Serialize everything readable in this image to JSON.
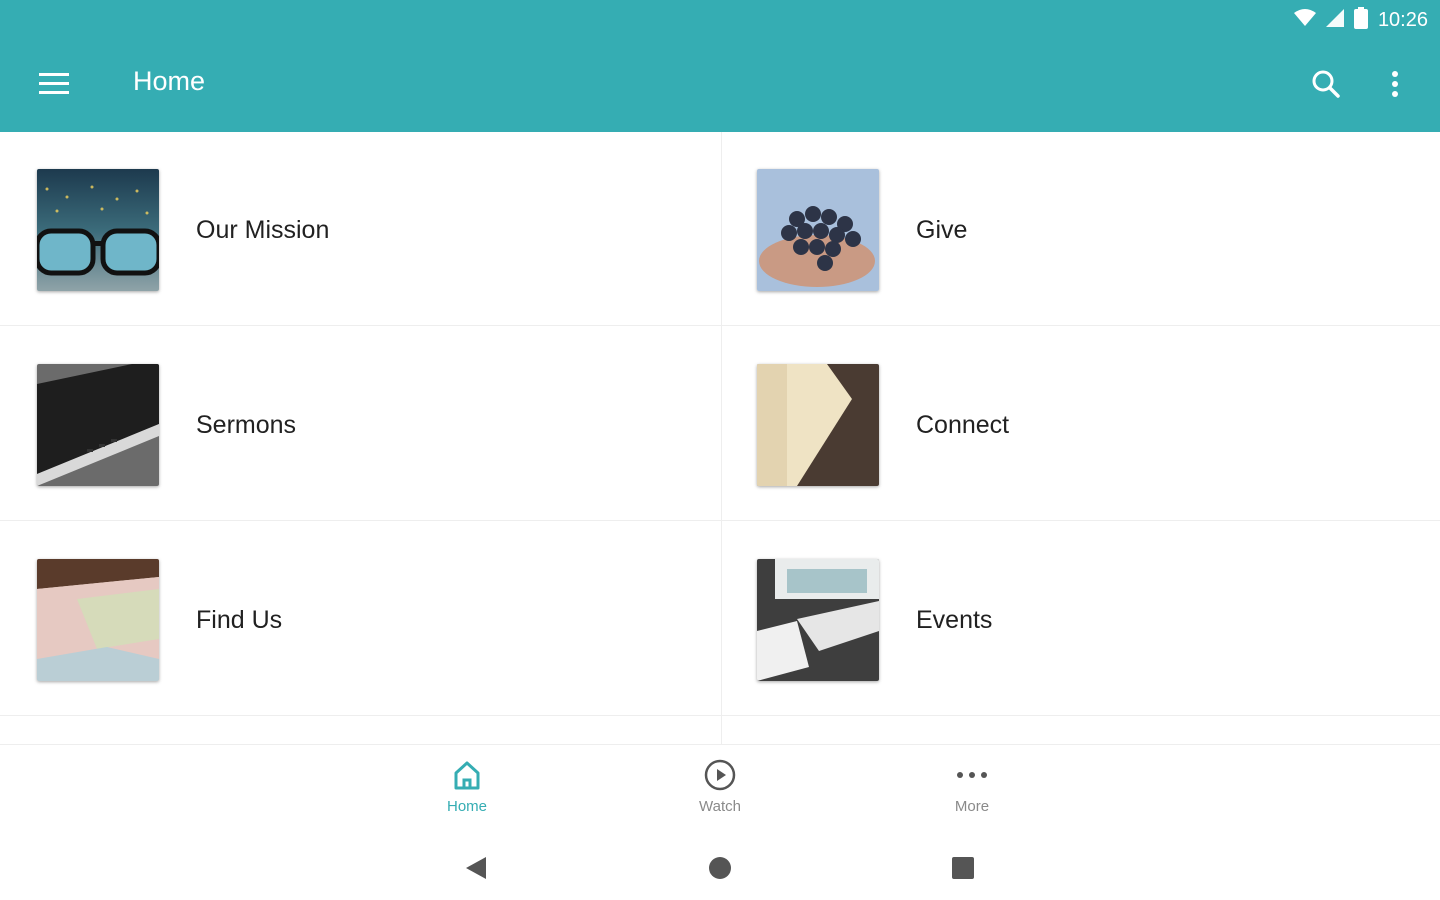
{
  "status_bar": {
    "time": "10:26"
  },
  "app_bar": {
    "title": "Home"
  },
  "tiles": [
    {
      "label": "Our Mission"
    },
    {
      "label": "Give"
    },
    {
      "label": "Sermons"
    },
    {
      "label": "Connect"
    },
    {
      "label": "Find Us"
    },
    {
      "label": "Events"
    }
  ],
  "bottom_nav": {
    "items": [
      {
        "label": "Home",
        "active": true
      },
      {
        "label": "Watch",
        "active": false
      },
      {
        "label": "More",
        "active": false
      }
    ]
  },
  "colors": {
    "accent": "#35adb3",
    "text": "#212121",
    "inactive": "#8a8a8a"
  }
}
